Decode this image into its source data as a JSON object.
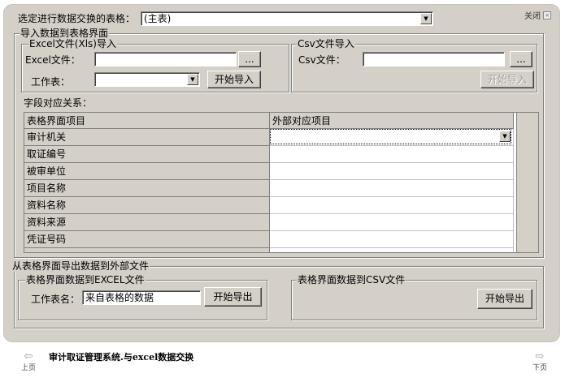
{
  "header": {
    "select_label": "选定进行数据交换的表格：",
    "table_select_value": "(主表)",
    "close_label": "关闭"
  },
  "import_section": {
    "title": "导入数据到表格界面",
    "excel": {
      "title": "Excel文件(Xls)导入",
      "file_label": "Excel文件：",
      "file_value": "",
      "browse_label": "...",
      "sheet_label": "工作表：",
      "sheet_value": "",
      "start_button": "开始导入"
    },
    "csv": {
      "title": "Csv文件导入",
      "file_label": "Csv文件：",
      "file_value": "",
      "browse_label": "...",
      "start_button": "开始导入"
    },
    "mapping_label": "字段对应关系：",
    "grid": {
      "columns": [
        "表格界面项目",
        "外部对应项目"
      ],
      "rows": [
        "审计机关",
        "取证编号",
        "被审单位",
        "项目名称",
        "资料名称",
        "资料来源",
        "凭证号码"
      ]
    }
  },
  "export_section": {
    "title": "从表格界面导出数据到外部文件",
    "excel": {
      "title": "表格界面数据到EXCEL文件",
      "sheet_label": "工作表名：",
      "sheet_value": "来自表格的数据",
      "start_button": "开始导出"
    },
    "csv": {
      "title": "表格界面数据到CSV文件",
      "start_button": "开始导出"
    }
  },
  "footer": {
    "prev_label": "上页",
    "next_label": "下页",
    "caption": "审计取证管理系统.与excel数据交换"
  },
  "icons": {
    "dropdown": "chevron-down-icon",
    "close": "close-icon",
    "prev": "arrow-left-icon",
    "next": "arrow-right-icon"
  }
}
